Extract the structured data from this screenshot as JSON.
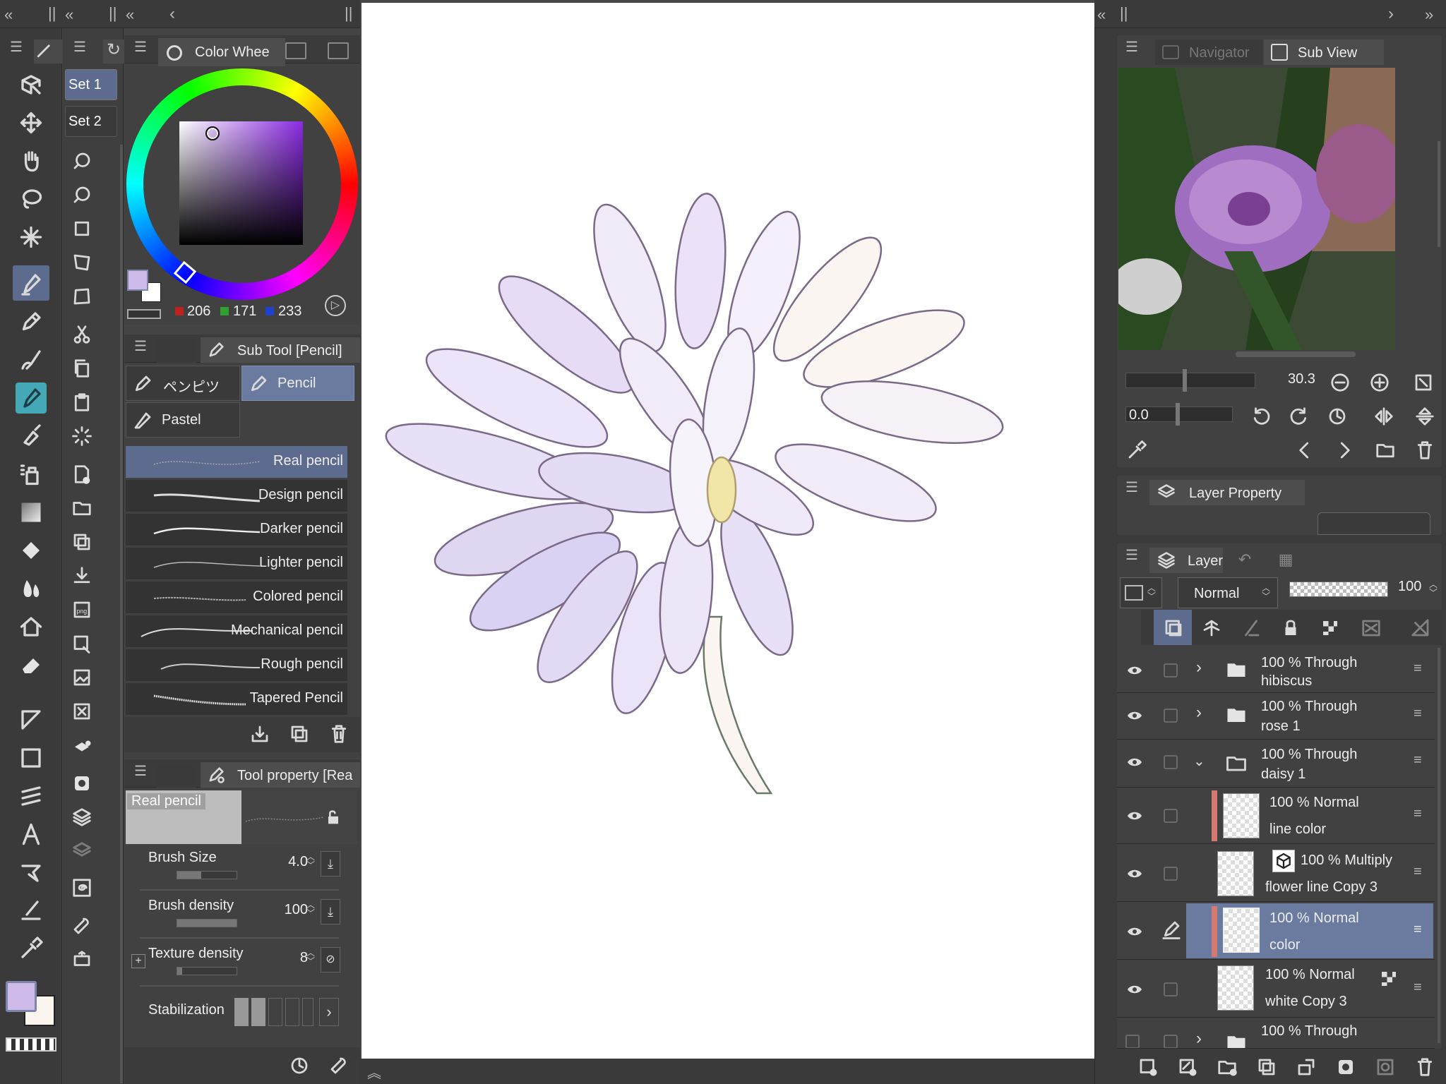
{
  "colors": {
    "main": "#cebbe9",
    "sub": "#fbf5ef",
    "accent_selected": "#6b7a9f"
  },
  "sets": {
    "set1": "Set 1",
    "set2": "Set 2"
  },
  "color_panel": {
    "tab_label": "Color Whee",
    "r": "206",
    "g": "171",
    "b": "233"
  },
  "sub_tool": {
    "tab_label": "Sub Tool [Pencil]",
    "groups": [
      "ペンピツ",
      "Pencil",
      "Pastel"
    ],
    "brushes": [
      "Real pencil",
      "Design pencil",
      "Darker pencil",
      "Lighter pencil",
      "Colored pencil",
      "Mechanical pencil",
      "Rough pencil",
      "Tapered Pencil"
    ]
  },
  "tool_property": {
    "tab_label": "Tool property [Rea",
    "preview_label": "Real pencil",
    "brush_size_label": "Brush Size",
    "brush_size": "4.0",
    "brush_density_label": "Brush density",
    "brush_density": "100",
    "texture_density_label": "Texture density",
    "texture_density": "8",
    "stabilization_label": "Stabilization"
  },
  "navigator": {
    "tab_navigator": "Navigator",
    "tab_subview": "Sub View",
    "zoom": "30.3",
    "rotation": "0.0"
  },
  "layer_property": {
    "tab_label": "Layer Property"
  },
  "layer_panel": {
    "tab_label": "Layer",
    "blend_mode": "Normal",
    "opacity": "100",
    "layers": [
      {
        "line1": "100 % Through",
        "line2": "hibiscus"
      },
      {
        "line1": "100 % Through",
        "line2": "rose 1"
      },
      {
        "line1": "100 % Through",
        "line2": "daisy 1"
      },
      {
        "line1": "100 % Normal",
        "line2": "line color"
      },
      {
        "line1": "100 % Multiply",
        "line2": "flower line Copy 3"
      },
      {
        "line1": "100 % Normal",
        "line2": "color"
      },
      {
        "line1": "100 % Normal",
        "line2": "white Copy 3"
      },
      {
        "line1": "100 % Through",
        "line2": ""
      }
    ]
  }
}
